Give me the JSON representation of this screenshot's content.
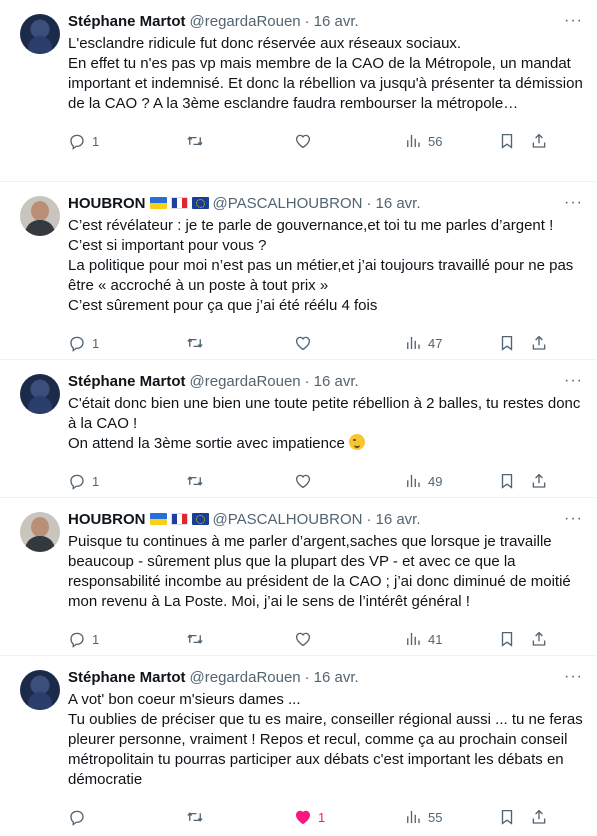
{
  "colors": {
    "text": "#0f1419",
    "secondary": "#536471",
    "like_active": "#f91880",
    "divider": "#eff3f4"
  },
  "icons": [
    "reply-icon",
    "retweet-icon",
    "like-icon",
    "views-icon",
    "bookmark-icon",
    "share-icon",
    "more-icon"
  ],
  "tweets": [
    {
      "author": "Stéphane Martot",
      "handle": "@regardaRouen",
      "sep": "·",
      "date": "16 avr.",
      "more": "···",
      "text": "L'esclandre ridicule fut donc réservée aux réseaux sociaux.\nEn effet tu n'es pas vp mais membre de la CAO de la Métropole, un mandat important et indemnisé. Et donc la rébellion va jusqu'à présenter ta démission de la CAO ? A la 3ème esclandre faudra rembourser la métropole…",
      "replies": "1",
      "likes": "",
      "views": "56"
    },
    {
      "author": "HOUBRON",
      "handle": "@PASCALHOUBRON",
      "sep": "·",
      "date": "16 avr.",
      "more": "···",
      "text": "C’est révélateur : je te parle de gouvernance,et toi tu me parles d’argent !\nC’est si important pour vous ?\nLa politique pour moi n’est pas un métier,et j’ai toujours travaillé pour ne pas être « accroché à un poste à tout prix »\nC’est sûrement pour ça que j’ai été réélu 4 fois",
      "replies": "1",
      "likes": "",
      "views": "47"
    },
    {
      "author": "Stéphane Martot",
      "handle": "@regardaRouen",
      "sep": "·",
      "date": "16 avr.",
      "more": "···",
      "text": "C'était donc bien une bien une toute petite rébellion à 2 balles, tu restes donc à la CAO !\nOn attend la 3ème sortie avec impatience",
      "replies": "1",
      "likes": "",
      "views": "49"
    },
    {
      "author": "HOUBRON",
      "handle": "@PASCALHOUBRON",
      "sep": "·",
      "date": "16 avr.",
      "more": "···",
      "text": "Puisque tu continues à me parler d’argent,saches que lorsque je travaille beaucoup - sûrement plus que la plupart des VP - et avec ce que la responsabilité incombe au président de la CAO ; j’ai donc diminué de moitié mon revenu à La Poste. Moi, j’ai le sens de l’intérêt général !",
      "replies": "1",
      "likes": "",
      "views": "41"
    },
    {
      "author": "Stéphane Martot",
      "handle": "@regardaRouen",
      "sep": "·",
      "date": "16 avr.",
      "more": "···",
      "text": "A vot' bon coeur m'sieurs dames ...\nTu oublies de préciser que tu es maire, conseiller régional aussi ... tu ne feras pleurer personne, vraiment ! Repos et recul, comme ça au prochain conseil métropolitain tu pourras participer aux débats c'est important les débats en démocratie",
      "replies": "",
      "likes": "1",
      "views": "55"
    }
  ]
}
